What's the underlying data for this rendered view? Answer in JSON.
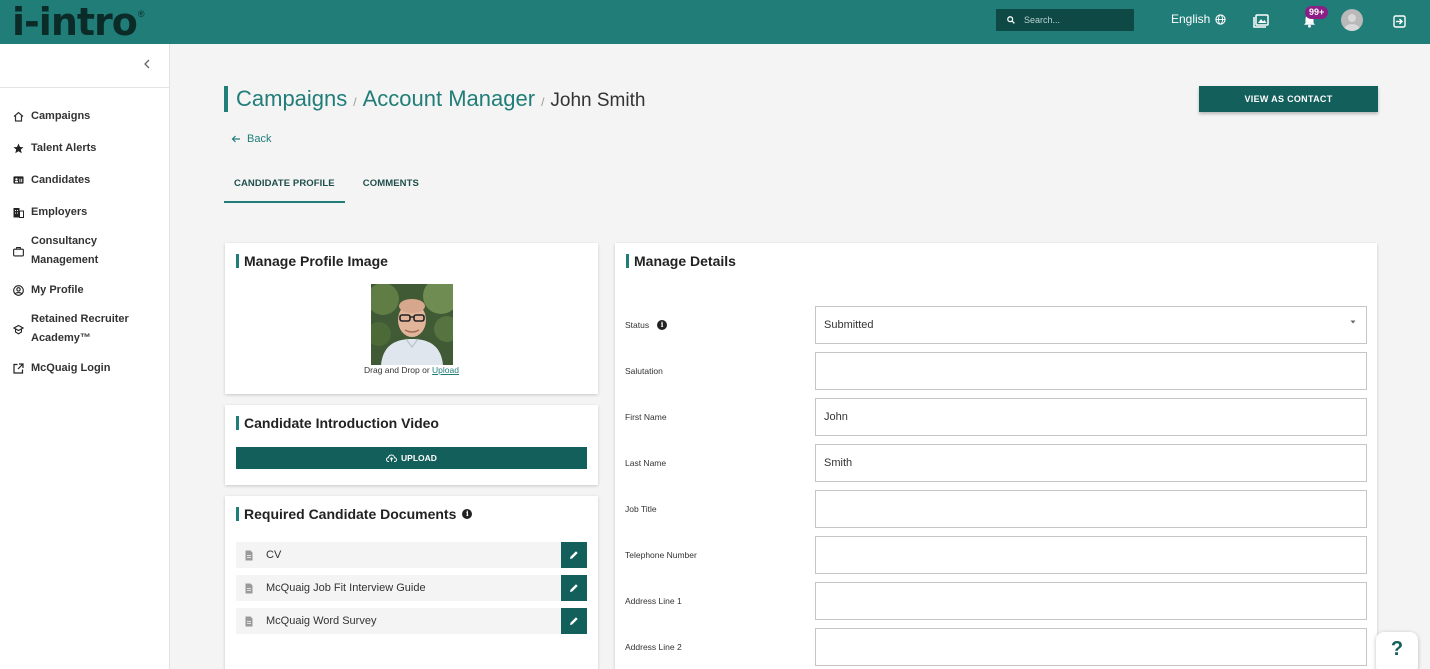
{
  "app": {
    "logo": "i-intro",
    "logo_mark": "®"
  },
  "topbar": {
    "search_placeholder": "Search...",
    "language": "English",
    "notification_count": "99+"
  },
  "sidebar": {
    "items": [
      {
        "label": "Campaigns",
        "icon": "home-icon"
      },
      {
        "label": "Talent Alerts",
        "icon": "star-icon"
      },
      {
        "label": "Candidates",
        "icon": "id-card-icon"
      },
      {
        "label": "Employers",
        "icon": "building-icon"
      },
      {
        "label": "Consultancy Management",
        "icon": "briefcase-icon"
      },
      {
        "label": "My Profile",
        "icon": "user-circle-icon"
      },
      {
        "label": "Retained Recruiter Academy™",
        "icon": "academy-icon"
      },
      {
        "label": "McQuaig Login",
        "icon": "external-link-icon"
      }
    ]
  },
  "breadcrumb": {
    "campaigns": "Campaigns",
    "role": "Account Manager",
    "candidate": "John Smith",
    "separator": "/"
  },
  "actions": {
    "view_as_contact": "VIEW AS CONTACT",
    "back": "Back"
  },
  "tabs": [
    {
      "label": "CANDIDATE PROFILE",
      "active": true
    },
    {
      "label": "COMMENTS",
      "active": false
    }
  ],
  "profile_image": {
    "title": "Manage Profile Image",
    "caption_prefix": "Drag and Drop or",
    "upload_link": "Upload"
  },
  "intro_video": {
    "title": "Candidate Introduction Video",
    "upload_label": "UPLOAD"
  },
  "documents": {
    "title": "Required Candidate Documents",
    "items": [
      "CV",
      "McQuaig Job Fit Interview Guide",
      "McQuaig Word Survey"
    ]
  },
  "details": {
    "title": "Manage Details",
    "fields": [
      {
        "label": "Status",
        "value": "Submitted",
        "type": "select",
        "info": true
      },
      {
        "label": "Salutation",
        "value": "",
        "type": "text"
      },
      {
        "label": "First Name",
        "value": "John",
        "type": "text"
      },
      {
        "label": "Last Name",
        "value": "Smith",
        "type": "text"
      },
      {
        "label": "Job Title",
        "value": "",
        "type": "text"
      },
      {
        "label": "Telephone Number",
        "value": "",
        "type": "text"
      },
      {
        "label": "Address Line 1",
        "value": "",
        "type": "text"
      },
      {
        "label": "Address Line 2",
        "value": "",
        "type": "text"
      }
    ]
  },
  "help": {
    "label": "?"
  },
  "colors": {
    "brand": "#207d78",
    "brand_dark": "#135f5b",
    "badge": "#8b1f86"
  }
}
